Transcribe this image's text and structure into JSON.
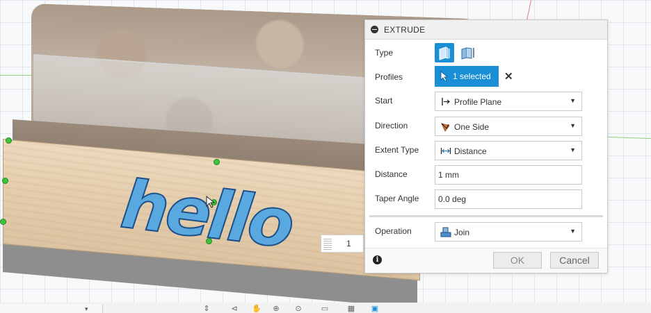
{
  "viewport": {
    "model_text": "hello",
    "dimension_value": "1",
    "colors": {
      "grid": "#e3e6ea",
      "sketch_text_fill": "#5aa8e0",
      "handle": "#3ec33e"
    }
  },
  "dialog": {
    "title": "EXTRUDE",
    "rows": {
      "type": {
        "label": "Type"
      },
      "profiles": {
        "label": "Profiles",
        "value": "1 selected"
      },
      "start": {
        "label": "Start",
        "value": "Profile Plane"
      },
      "direction": {
        "label": "Direction",
        "value": "One Side"
      },
      "extent_type": {
        "label": "Extent Type",
        "value": "Distance"
      },
      "distance": {
        "label": "Distance",
        "value": "1 mm"
      },
      "taper_angle": {
        "label": "Taper Angle",
        "value": "0.0 deg"
      },
      "operation": {
        "label": "Operation",
        "value": "Join"
      }
    },
    "buttons": {
      "ok": "OK",
      "cancel": "Cancel"
    },
    "colors": {
      "accent": "#1b8fd6"
    }
  },
  "icons": {
    "collapse": "minus-circle-icon",
    "type_solid": "solid-extrude-icon",
    "type_surface": "surface-extrude-icon",
    "profiles": "select-pointer-icon",
    "clear": "close-icon",
    "start": "profile-plane-icon",
    "direction": "one-side-icon",
    "extent": "distance-icon",
    "operation": "join-icon",
    "info": "info-icon"
  }
}
